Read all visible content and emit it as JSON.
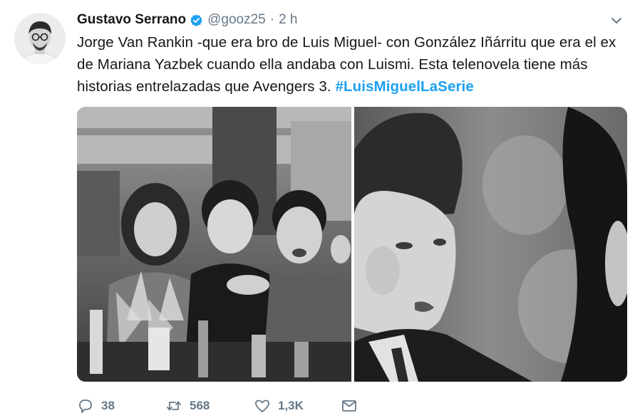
{
  "author": {
    "display_name": "Gustavo Serrano",
    "verified": true,
    "handle": "@gooz25",
    "separator": "·",
    "timestamp": "2 h"
  },
  "tweet": {
    "lines": [
      "Jorge Van Rankin -que era bro de Luis Miguel- con González Iñárritu que era el ex",
      "de Mariana Yazbek cuando ella andaba con Luismi. Esta telenovela tiene más",
      "historias entrelazadas que Avengers 3. "
    ],
    "hashtag": "#LuisMiguelLaSerie"
  },
  "media": {
    "count": 2,
    "style": "black-and-white photographs"
  },
  "actions": {
    "reply_count": "38",
    "retweet_count": "568",
    "like_count": "1,3K"
  },
  "icons": {
    "verified": "verified-badge-icon",
    "caret": "chevron-down-icon",
    "reply": "reply-icon",
    "retweet": "retweet-icon",
    "like": "heart-icon",
    "dm": "envelope-icon"
  },
  "colors": {
    "link": "#1da1f2",
    "secondary_text": "#657786",
    "primary_text": "#14171a",
    "verified": "#1da1f2"
  }
}
